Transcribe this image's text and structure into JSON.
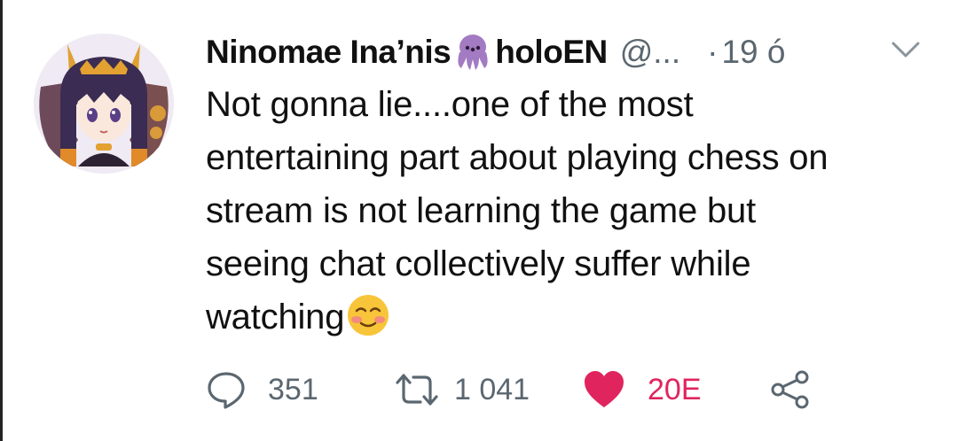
{
  "tweet": {
    "display_name": "Ninomae Ina’nis",
    "display_name_suffix": "holoEN",
    "handle": "@...",
    "separator": "·",
    "time": "19 ó",
    "text_lines": [
      "Not gonna lie....one of the most",
      "entertaining part about playing chess on",
      "stream is not learning the game but",
      "seeing chat collectively suffer while",
      "watching"
    ],
    "name_emoji": "octopus-emoji",
    "text_emoji": "smiling-blushing-emoji"
  },
  "actions": {
    "reply_count": "351",
    "retweet_count": "1 041",
    "like_count": "20E",
    "like_color": "#e0245e",
    "muted_color": "#5b6770"
  },
  "icons": {
    "reply": "reply-bubble-icon",
    "retweet": "retweet-icon",
    "like": "heart-icon",
    "share": "share-icon",
    "menu": "chevron-down-icon"
  }
}
